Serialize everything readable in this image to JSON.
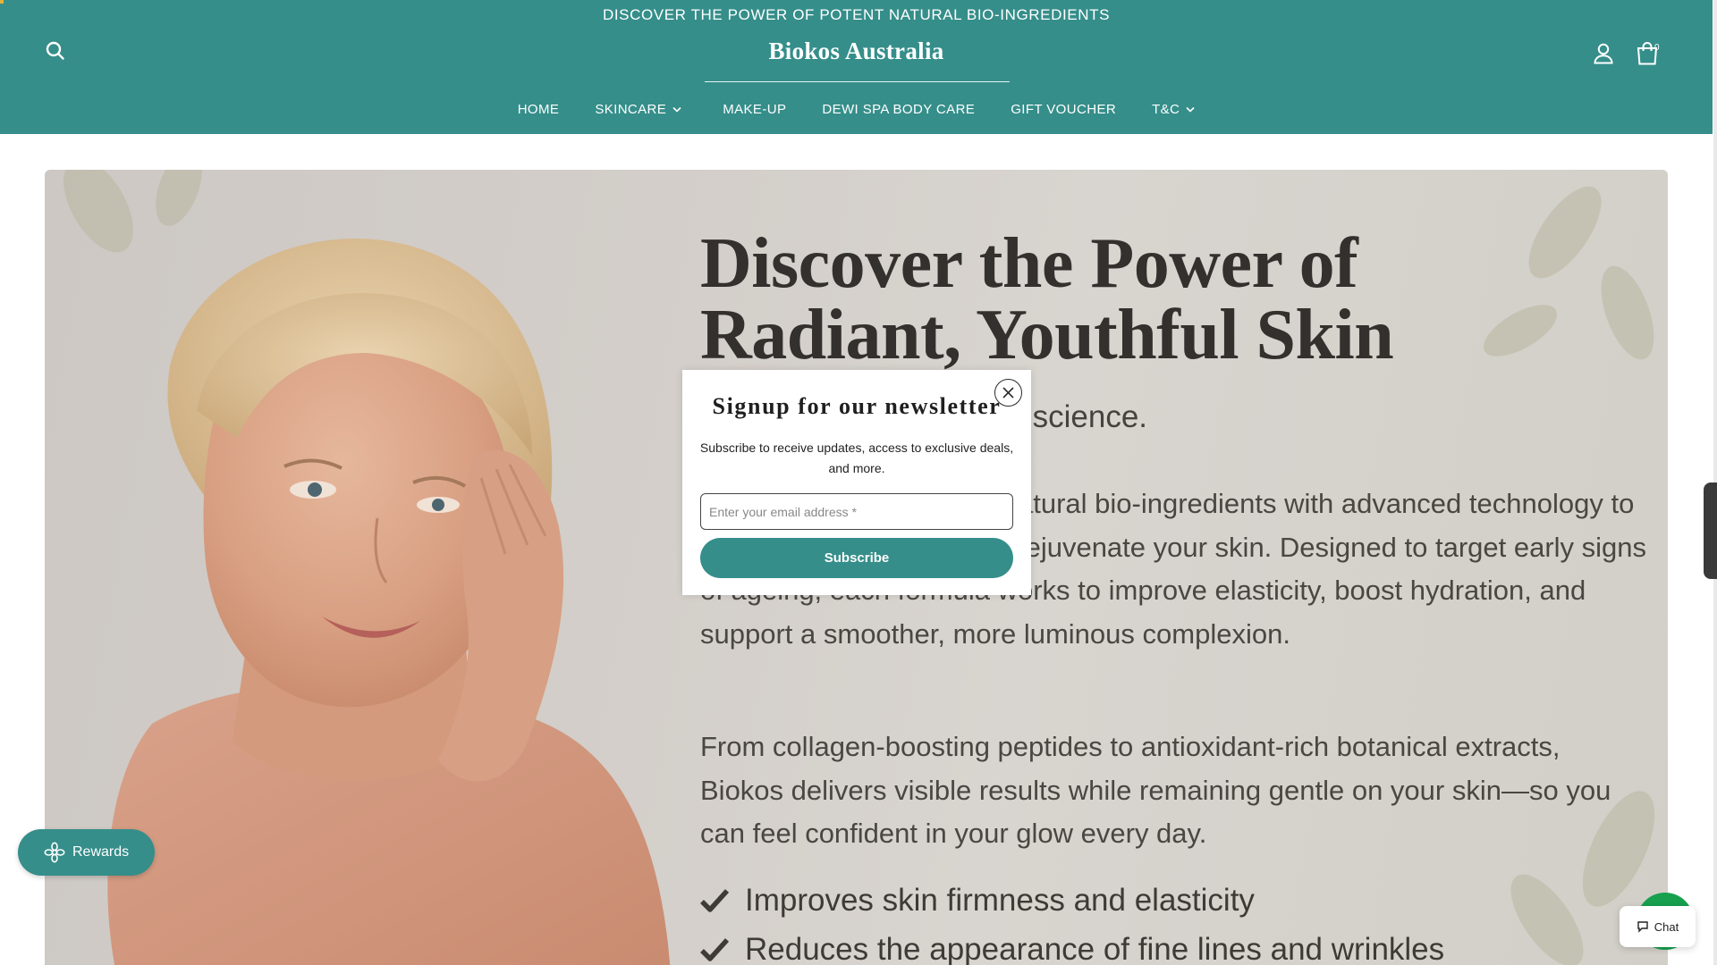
{
  "announcement": "DISCOVER THE POWER OF POTENT NATURAL BIO-INGREDIENTS",
  "header": {
    "brand": "Biokos Australia",
    "cart_count": "0",
    "icons": {
      "search": "search-icon",
      "account": "account-icon",
      "cart": "shopping-bag-icon"
    },
    "colors": {
      "header_bg": "#358e8a",
      "text": "#ffffff"
    }
  },
  "nav": {
    "items": [
      {
        "label": "HOME",
        "has_dropdown": false
      },
      {
        "label": "SKINCARE",
        "has_dropdown": true
      },
      {
        "label": "MAKE-UP",
        "has_dropdown": false
      },
      {
        "label": "DEWI SPA BODY CARE",
        "has_dropdown": false
      },
      {
        "label": "GIFT VOUCHER",
        "has_dropdown": false
      },
      {
        "label": "T&C",
        "has_dropdown": true
      }
    ]
  },
  "hero": {
    "title_line1": "Discover the Power of",
    "title_line2": "Radiant, Youthful Skin",
    "subtitle": "Powered by nature and science.",
    "paragraph1": "Biokos combines potent natural bio-ingredients with advanced technology to help restore, protect, and rejuvenate your skin. Designed to target early signs of ageing, each formula works to improve elasticity, boost hydration, and support a smoother, more luminous complexion.",
    "paragraph2": "From collagen-boosting peptides to antioxidant-rich botanical extracts, Biokos delivers visible results while remaining gentle on your skin—so you can feel confident in your glow every day.",
    "benefits": [
      "Improves skin firmness and elasticity",
      "Reduces the appearance of fine lines and wrinkles"
    ]
  },
  "newsletter": {
    "title": "Signup for our newsletter",
    "description": "Subscribe to receive updates, access to exclusive deals, and more.",
    "email_placeholder": "Enter your email address *",
    "email_value": "",
    "submit_label": "Subscribe",
    "close_icon": "close-icon"
  },
  "widgets": {
    "rewards_label": "Rewards",
    "chat_label": "Chat",
    "colors": {
      "rewards_bg": "#358e8a",
      "chat_accent": "#17a04e"
    }
  }
}
